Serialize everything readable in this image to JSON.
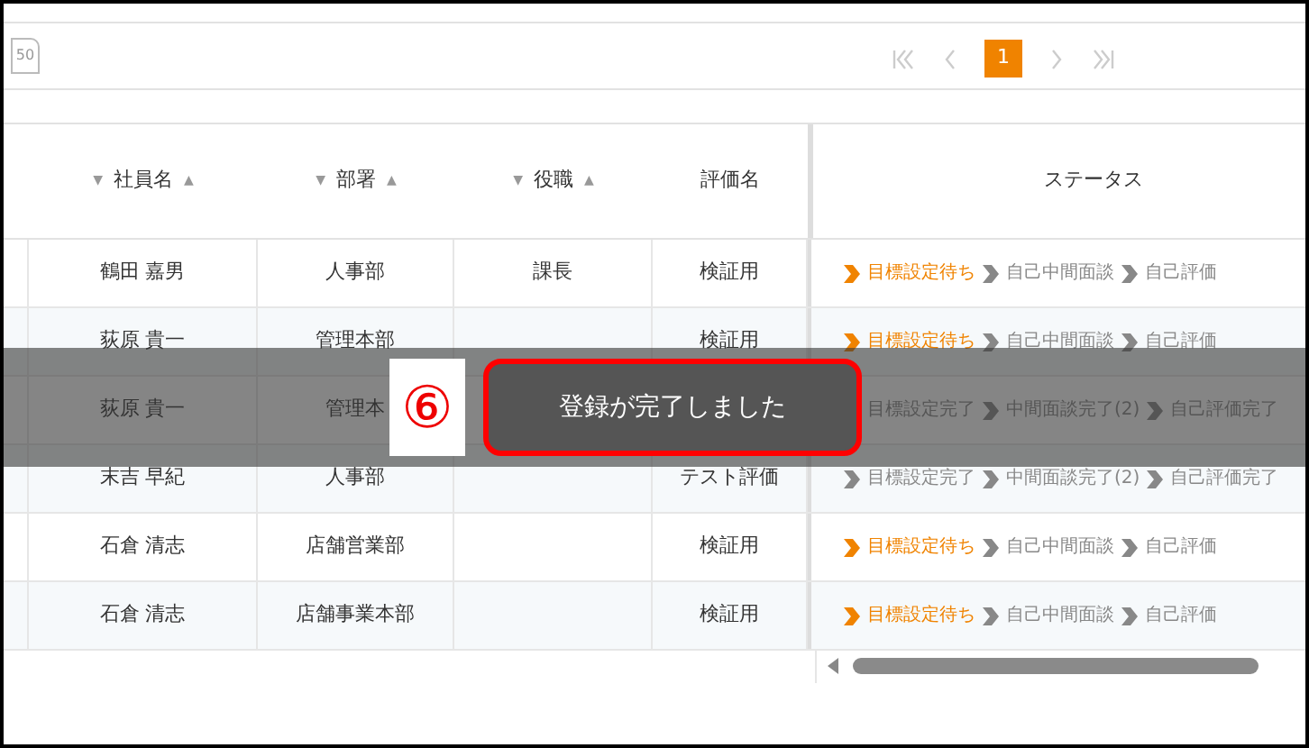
{
  "toolbar": {
    "page_size": "50"
  },
  "pagination": {
    "pages": [
      {
        "label": "1",
        "selected": true
      }
    ]
  },
  "table": {
    "columns": [
      {
        "label": "社員名",
        "sort_desc": "▼",
        "sort_asc": "▲"
      },
      {
        "label": "部署",
        "sort_desc": "▼",
        "sort_asc": "▲"
      },
      {
        "label": "役職",
        "sort_desc": "▼",
        "sort_asc": "▲"
      },
      {
        "label": "評価名"
      },
      {
        "label": "ステータス"
      }
    ],
    "rows": [
      {
        "name": "鶴田 嘉男",
        "dept": "人事部",
        "title": "課長",
        "eval": "検証用",
        "steps": [
          {
            "label": "目標設定待ち",
            "active": true
          },
          {
            "label": "自己中間面談",
            "active": false
          },
          {
            "label": "自己評価",
            "active": false
          }
        ]
      },
      {
        "name": "荻原 貴一",
        "dept": "管理本部",
        "title": "",
        "eval": "検証用",
        "steps": [
          {
            "label": "目標設定待ち",
            "active": true
          },
          {
            "label": "自己中間面談",
            "active": false
          },
          {
            "label": "自己評価",
            "active": false
          }
        ]
      },
      {
        "name": "荻原 貴一",
        "dept": "管理本",
        "title": "",
        "eval": "",
        "steps": [
          {
            "label": "目標設定完了",
            "active": false
          },
          {
            "label": "中間面談完了(2)",
            "active": false
          },
          {
            "label": "自己評価完了",
            "active": false
          }
        ]
      },
      {
        "name": "末吉 早紀",
        "dept": "人事部",
        "title": "",
        "eval": "テスト評価",
        "steps": [
          {
            "label": "目標設定完了",
            "active": false
          },
          {
            "label": "中間面談完了(2)",
            "active": false
          },
          {
            "label": "自己評価完了",
            "active": false
          }
        ]
      },
      {
        "name": "石倉 清志",
        "dept": "店舗営業部",
        "title": "",
        "eval": "検証用",
        "steps": [
          {
            "label": "目標設定待ち",
            "active": true
          },
          {
            "label": "自己中間面談",
            "active": false
          },
          {
            "label": "自己評価",
            "active": false
          }
        ]
      },
      {
        "name": "石倉 清志",
        "dept": "店舗事業本部",
        "title": "",
        "eval": "検証用",
        "steps": [
          {
            "label": "目標設定待ち",
            "active": true
          },
          {
            "label": "自己中間面談",
            "active": false
          },
          {
            "label": "自己評価",
            "active": false
          }
        ]
      }
    ]
  },
  "toast": {
    "step_number": "⑥",
    "message": "登録が完了しました"
  }
}
